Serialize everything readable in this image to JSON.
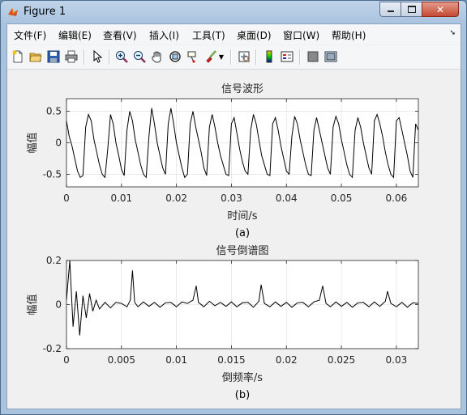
{
  "window": {
    "title": "Figure 1"
  },
  "menu": [
    "文件(F)",
    "编辑(E)",
    "查看(V)",
    "插入(I)",
    "工具(T)",
    "桌面(D)",
    "窗口(W)",
    "帮助(H)"
  ],
  "toolbar": [
    "new-figure-icon",
    "open-file-icon",
    "save-icon",
    "print-icon",
    "select-arrow-icon",
    "zoom-in-icon",
    "zoom-out-icon",
    "pan-hand-icon",
    "rotate-3d-icon",
    "data-cursor-icon",
    "brush-icon",
    "brush-dropdown-icon",
    "link-plot-icon",
    "colorbar-icon",
    "legend-icon",
    "hide-plot-tools-icon",
    "show-plot-tools-icon"
  ],
  "colors": {
    "axes_bg": "#ffffff",
    "figure_bg": "#f0f0f0",
    "line": "#000000",
    "grid": "#e6e6e6"
  },
  "chart_data": [
    {
      "type": "line",
      "title": "信号波形",
      "xlabel": "时间/s",
      "ylabel": "幅值",
      "caption": "(a)",
      "xlim": [
        0,
        0.064
      ],
      "ylim": [
        -0.7,
        0.7
      ],
      "xticks": [
        0,
        0.01,
        0.02,
        0.03,
        0.04,
        0.05,
        0.06
      ],
      "xticklabels": [
        "0",
        "0.01",
        "0.02",
        "0.03",
        "0.04",
        "0.05",
        "0.06"
      ],
      "yticks": [
        -0.5,
        0,
        0.5
      ],
      "yticklabels": [
        "-0.5",
        "0",
        "0.5"
      ],
      "grid": true,
      "series": [
        {
          "x": [
            0,
            0.0005,
            0.001,
            0.0015,
            0.002,
            0.0025,
            0.003,
            0.0035,
            0.004,
            0.0045,
            0.005,
            0.0055,
            0.006,
            0.0065,
            0.007,
            0.0075,
            0.008,
            0.0085,
            0.009,
            0.0095,
            0.01,
            0.0105,
            0.011,
            0.0115,
            0.012,
            0.0125,
            0.013,
            0.0135,
            0.014,
            0.0145,
            0.015,
            0.0155,
            0.016,
            0.0165,
            0.017,
            0.0175,
            0.018,
            0.0185,
            0.019,
            0.0195,
            0.02,
            0.0205,
            0.021,
            0.0215,
            0.022,
            0.0225,
            0.023,
            0.0235,
            0.024,
            0.0245,
            0.025,
            0.0255,
            0.026,
            0.0265,
            0.027,
            0.0275,
            0.028,
            0.0285,
            0.029,
            0.0295,
            0.03,
            0.0305,
            0.031,
            0.0315,
            0.032,
            0.0325,
            0.033,
            0.0335,
            0.034,
            0.0345,
            0.035,
            0.0355,
            0.036,
            0.0365,
            0.037,
            0.0375,
            0.038,
            0.0385,
            0.039,
            0.0395,
            0.04,
            0.0405,
            0.041,
            0.0415,
            0.042,
            0.0425,
            0.043,
            0.0435,
            0.044,
            0.0445,
            0.045,
            0.0455,
            0.046,
            0.0465,
            0.047,
            0.0475,
            0.048,
            0.0485,
            0.049,
            0.0495,
            0.05,
            0.0505,
            0.051,
            0.0515,
            0.052,
            0.0525,
            0.053,
            0.0535,
            0.054,
            0.0545,
            0.055,
            0.0555,
            0.056,
            0.0565,
            0.057,
            0.0575,
            0.058,
            0.0585,
            0.059,
            0.0595,
            0.06,
            0.0605,
            0.061,
            0.0615,
            0.062,
            0.0625,
            0.063,
            0.0635,
            0.064
          ],
          "y": [
            0.35,
            0.1,
            -0.05,
            -0.25,
            -0.45,
            -0.55,
            -0.52,
            0.25,
            0.45,
            0.35,
            0.05,
            -0.15,
            -0.35,
            -0.5,
            -0.55,
            -0.1,
            0.45,
            0.3,
            0.0,
            -0.2,
            -0.42,
            -0.52,
            0.2,
            0.5,
            0.35,
            0.05,
            -0.15,
            -0.35,
            -0.5,
            -0.55,
            0.1,
            0.55,
            0.3,
            0.0,
            -0.2,
            -0.4,
            -0.5,
            0.3,
            0.55,
            0.3,
            0.0,
            -0.2,
            -0.4,
            -0.55,
            -0.5,
            0.3,
            0.5,
            0.25,
            0.05,
            -0.15,
            -0.4,
            -0.52,
            0.25,
            0.45,
            0.25,
            0.0,
            -0.2,
            -0.35,
            -0.5,
            -0.52,
            0.3,
            0.4,
            0.15,
            -0.1,
            -0.3,
            -0.45,
            -0.5,
            0.2,
            0.45,
            0.3,
            0.05,
            -0.2,
            -0.35,
            -0.5,
            -0.52,
            0.3,
            0.4,
            0.2,
            -0.05,
            -0.25,
            -0.45,
            -0.5,
            0.1,
            0.42,
            0.3,
            0.05,
            -0.15,
            -0.35,
            -0.5,
            -0.52,
            0.2,
            0.4,
            0.2,
            0.0,
            -0.2,
            -0.4,
            -0.5,
            0.25,
            0.42,
            0.3,
            0.05,
            -0.15,
            -0.35,
            -0.5,
            -0.55,
            0.2,
            0.4,
            0.25,
            0.0,
            -0.2,
            -0.4,
            -0.5,
            0.35,
            0.45,
            0.3,
            0.1,
            -0.15,
            -0.35,
            -0.5,
            -0.55,
            0.35,
            0.4,
            0.2,
            0.0,
            -0.2,
            -0.45,
            -0.55,
            0.3,
            0.2
          ]
        }
      ]
    },
    {
      "type": "line",
      "title": "信号倒谱图",
      "xlabel": "倒频率/s",
      "ylabel": "幅值",
      "caption": "(b)",
      "xlim": [
        0,
        0.032
      ],
      "ylim": [
        -0.2,
        0.2
      ],
      "xticks": [
        0,
        0.005,
        0.01,
        0.015,
        0.02,
        0.025,
        0.03
      ],
      "xticklabels": [
        "0",
        "0.005",
        "0.01",
        "0.015",
        "0.02",
        "0.025",
        "0.03"
      ],
      "yticks": [
        -0.2,
        0,
        0.2
      ],
      "yticklabels": [
        "-0.2",
        "0",
        "0.2"
      ],
      "grid": true,
      "series": [
        {
          "x": [
            0,
            0.0003,
            0.0006,
            0.0009,
            0.0012,
            0.0015,
            0.0018,
            0.0021,
            0.0024,
            0.0027,
            0.003,
            0.0035,
            0.004,
            0.0045,
            0.005,
            0.0055,
            0.0058,
            0.006,
            0.0062,
            0.0065,
            0.007,
            0.0075,
            0.008,
            0.0085,
            0.009,
            0.0095,
            0.01,
            0.0105,
            0.011,
            0.0115,
            0.0118,
            0.012,
            0.0125,
            0.013,
            0.0135,
            0.014,
            0.0145,
            0.015,
            0.0155,
            0.016,
            0.0165,
            0.017,
            0.0175,
            0.0177,
            0.018,
            0.0185,
            0.019,
            0.0195,
            0.02,
            0.0205,
            0.021,
            0.0215,
            0.022,
            0.0225,
            0.023,
            0.0233,
            0.0236,
            0.024,
            0.0245,
            0.025,
            0.0255,
            0.026,
            0.0265,
            0.027,
            0.0275,
            0.028,
            0.0285,
            0.029,
            0.0292,
            0.0295,
            0.03,
            0.0305,
            0.031,
            0.0315,
            0.032
          ],
          "y": [
            0.02,
            0.2,
            -0.1,
            0.06,
            -0.14,
            0.04,
            -0.06,
            0.05,
            -0.03,
            0.02,
            -0.02,
            0.01,
            -0.015,
            0.01,
            0.005,
            -0.01,
            0.02,
            0.155,
            0.01,
            -0.01,
            0.012,
            -0.008,
            0.01,
            -0.012,
            0.008,
            0.01,
            -0.01,
            0.012,
            0.005,
            0.02,
            0.085,
            0.01,
            -0.01,
            0.015,
            -0.005,
            0.01,
            -0.008,
            0.012,
            -0.01,
            0.008,
            0.01,
            -0.012,
            0.015,
            0.09,
            0.005,
            -0.01,
            0.012,
            -0.008,
            0.01,
            -0.012,
            0.008,
            0.01,
            -0.01,
            0.012,
            0.02,
            0.085,
            0.005,
            -0.01,
            0.012,
            -0.008,
            0.01,
            -0.012,
            0.008,
            0.01,
            -0.01,
            0.012,
            -0.008,
            0.015,
            0.06,
            0.005,
            -0.01,
            0.01,
            -0.012,
            0.008,
            0.005
          ]
        }
      ]
    }
  ]
}
